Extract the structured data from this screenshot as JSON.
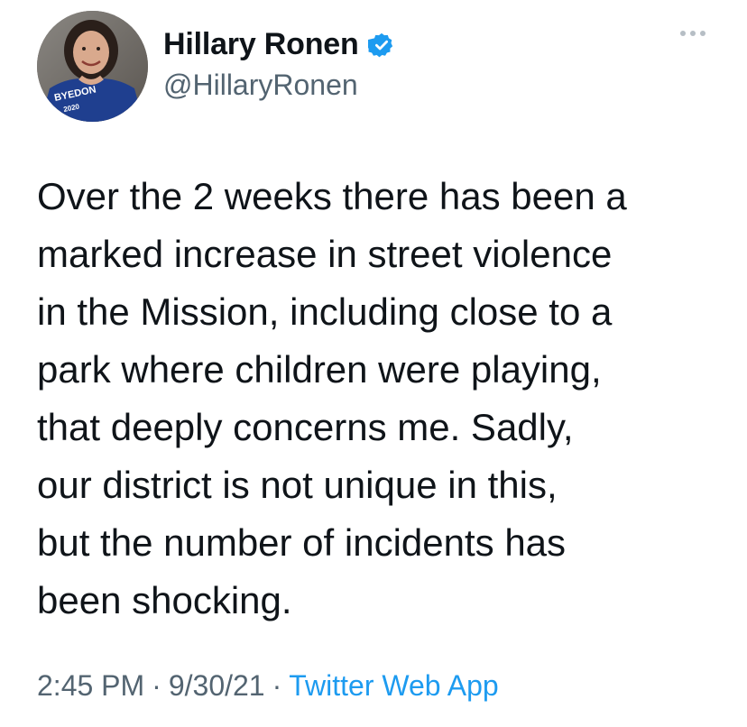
{
  "author": {
    "display_name": "Hillary Ronen",
    "handle": "@HillaryRonen",
    "verified": true,
    "avatar_shirt_text": "BYEDON",
    "avatar_shirt_year": "2020"
  },
  "tweet": {
    "text": "Over the 2 weeks there has been a\nmarked increase in street violence\nin the Mission, including close to a\npark where children were playing,\nthat deeply concerns me. Sadly,\nour district is not unique in this,\nbut the number of incidents has\nbeen shocking.",
    "time": "2:45 PM",
    "date": "9/30/21",
    "source": "Twitter Web App",
    "separator": "·"
  },
  "colors": {
    "text_primary": "#0f1419",
    "text_secondary": "#536471",
    "accent": "#1d9bf0",
    "verified_badge": "#1d9bf0"
  },
  "icons": {
    "verified": "verified-badge-icon",
    "more": "more-horizontal-icon"
  }
}
